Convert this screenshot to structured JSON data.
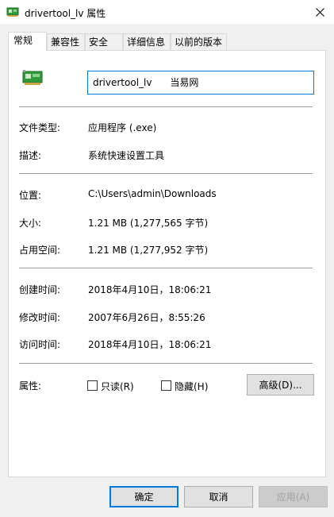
{
  "window": {
    "title": "drivertool_lv 属性"
  },
  "tabs": [
    {
      "label": "常规",
      "active": true
    },
    {
      "label": "兼容性"
    },
    {
      "label": "安全"
    },
    {
      "label": "详细信息"
    },
    {
      "label": "以前的版本"
    }
  ],
  "general": {
    "file_name_value": "drivertool_lv      当易网",
    "file_icon": "network-card-icon",
    "file_type_label": "文件类型:",
    "file_type_value": "应用程序 (.exe)",
    "description_label": "描述:",
    "description_value": "系统快速设置工具",
    "location_label": "位置:",
    "location_value": "C:\\Users\\admin\\Downloads",
    "size_label": "大小:",
    "size_value": "1.21 MB (1,277,565 字节)",
    "size_on_disk_label": "占用空间:",
    "size_on_disk_value": "1.21 MB (1,277,952 字节)",
    "created_label": "创建时间:",
    "created_value": "2018年4月10日，18:06:21",
    "modified_label": "修改时间:",
    "modified_value": "2007年6月26日，8:55:26",
    "accessed_label": "访问时间:",
    "accessed_value": "2018年4月10日，18:06:21",
    "attributes_label": "属性:",
    "readonly_label": "只读(R)",
    "readonly_checked": false,
    "hidden_label": "隐藏(H)",
    "hidden_checked": false,
    "advanced_button": "高级(D)..."
  },
  "footer": {
    "ok": "确定",
    "cancel": "取消",
    "apply": "应用(A)",
    "apply_enabled": false
  },
  "colors": {
    "accent": "#0078d7",
    "panel_bg": "#ffffff",
    "window_bg": "#f0f0f0",
    "separator": "#a0a0a0",
    "disabled_text": "#a0a0a0"
  }
}
